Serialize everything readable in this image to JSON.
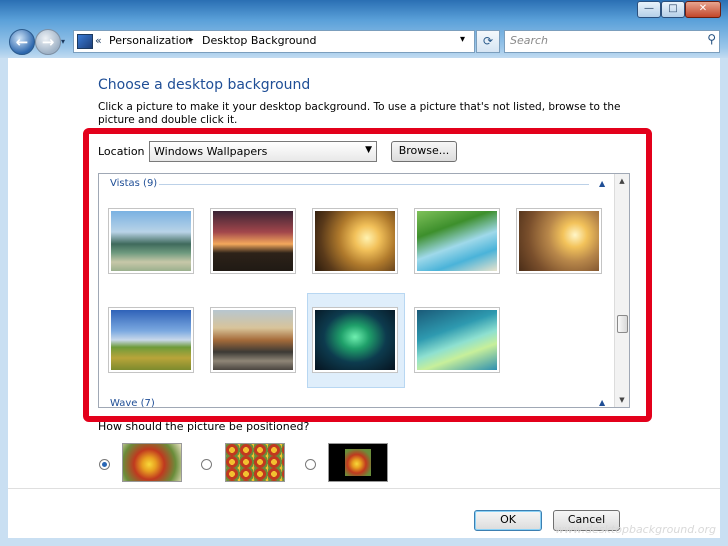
{
  "window": {
    "minimize_glyph": "—",
    "maximize_glyph": "□",
    "close_glyph": "✕"
  },
  "nav": {
    "back_icon": "back-arrow-icon",
    "forward_icon": "forward-arrow-icon",
    "breadcrumb_chevron": "«",
    "breadcrumb": [
      "Personalization",
      "Desktop Background"
    ],
    "breadcrumb_separator": "▸",
    "dropdown_glyph": "▾",
    "refresh_glyph": "⟳",
    "search_placeholder": "Search",
    "search_icon": "magnifier-icon"
  },
  "main": {
    "heading": "Choose a desktop background",
    "description": "Click a picture to make it your desktop background. To use a picture that's not listed, browse to the picture and double click it.",
    "location_label": "Location",
    "location_value": "Windows Wallpapers",
    "browse_label": "Browse...",
    "groups": [
      {
        "name": "Vistas (9)"
      },
      {
        "name": "Wave (7)"
      }
    ],
    "selected_thumbnail_index": 7,
    "position_question": "How should the picture be positioned?",
    "position_options": [
      {
        "name": "fill",
        "selected": true
      },
      {
        "name": "tile",
        "selected": false
      },
      {
        "name": "center",
        "selected": false
      }
    ],
    "ok_label": "OK",
    "cancel_label": "Cancel",
    "watermark": "www.desktopbackground.org"
  },
  "colors": {
    "highlight_frame": "#e3001b",
    "heading_blue": "#1f4e96"
  }
}
